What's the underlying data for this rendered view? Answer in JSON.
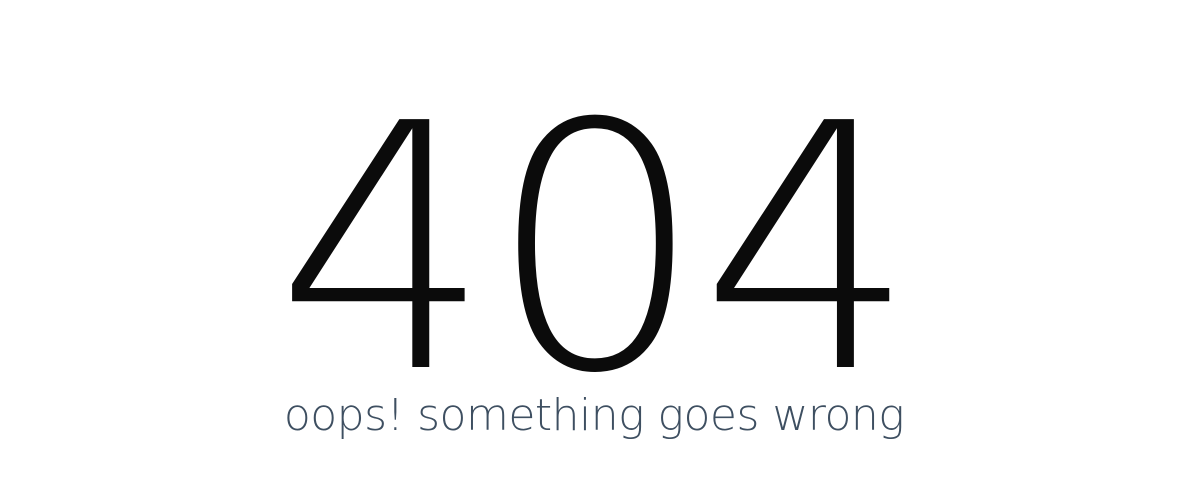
{
  "error": {
    "code": "404",
    "message": "oops! something goes wrong"
  },
  "colors": {
    "background": "#ffffff",
    "code": "#0b0b0b",
    "message": "#3e4f61"
  }
}
